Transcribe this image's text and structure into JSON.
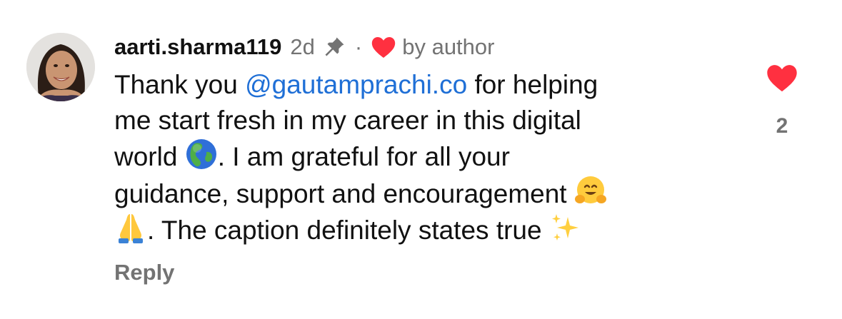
{
  "comment": {
    "username": "aarti.sharma119",
    "timestamp": "2d",
    "separator": "·",
    "liked_by_label": "by author",
    "text": {
      "line1_before": "Thank you ",
      "mention": "@gautamprachi.co",
      "line1_after": " for helping",
      "line2": "me start fresh in my career in this digital",
      "line3_before": "world ",
      "line3_after": ". I am grateful for all your",
      "line4": "guidance, support and encouragement ",
      "line5_after": ". The caption definitely states true "
    },
    "emojis": [
      "globe-americas",
      "hugging-face",
      "folded-hands",
      "sparkles"
    ],
    "reply_label": "Reply",
    "like_count": "2",
    "liked": true
  },
  "colors": {
    "like_red": "#ff3040",
    "mention_blue": "#1f6fd6",
    "secondary_text": "#737373"
  }
}
